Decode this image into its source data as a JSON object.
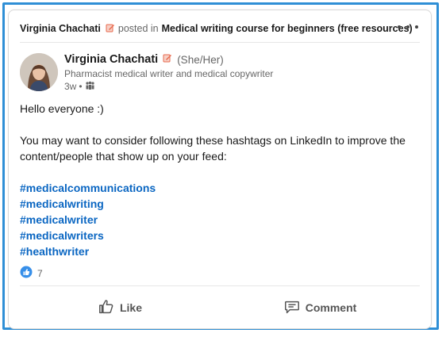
{
  "post_header": {
    "author_name": "Virginia Chachati",
    "posted_in_text": "posted in",
    "group_name": "Medical writing course for beginners (free resources)"
  },
  "author": {
    "name": "Virginia Chachati",
    "pronouns": "(She/Her)",
    "headline": "Pharmacist medical writer and medical copywriter",
    "age": "3w",
    "separator": "•",
    "visibility_icon": "group-icon"
  },
  "content": {
    "greeting": "Hello everyone :)",
    "paragraph": "You may want to consider following these hashtags on LinkedIn to improve the content/people that show up on your feed:",
    "hashtags": [
      "#medicalcommunications",
      "#medicalwriting",
      "#medicalwriter",
      "#medicalwriters",
      "#healthwriter"
    ]
  },
  "reactions": {
    "count": "7",
    "icon": "like-reaction-icon"
  },
  "actions": {
    "like_label": "Like",
    "comment_label": "Comment"
  },
  "colors": {
    "frame": "#2f8fd6",
    "hashtag": "#0a66c2",
    "edit_icon": "#e86a4e"
  }
}
